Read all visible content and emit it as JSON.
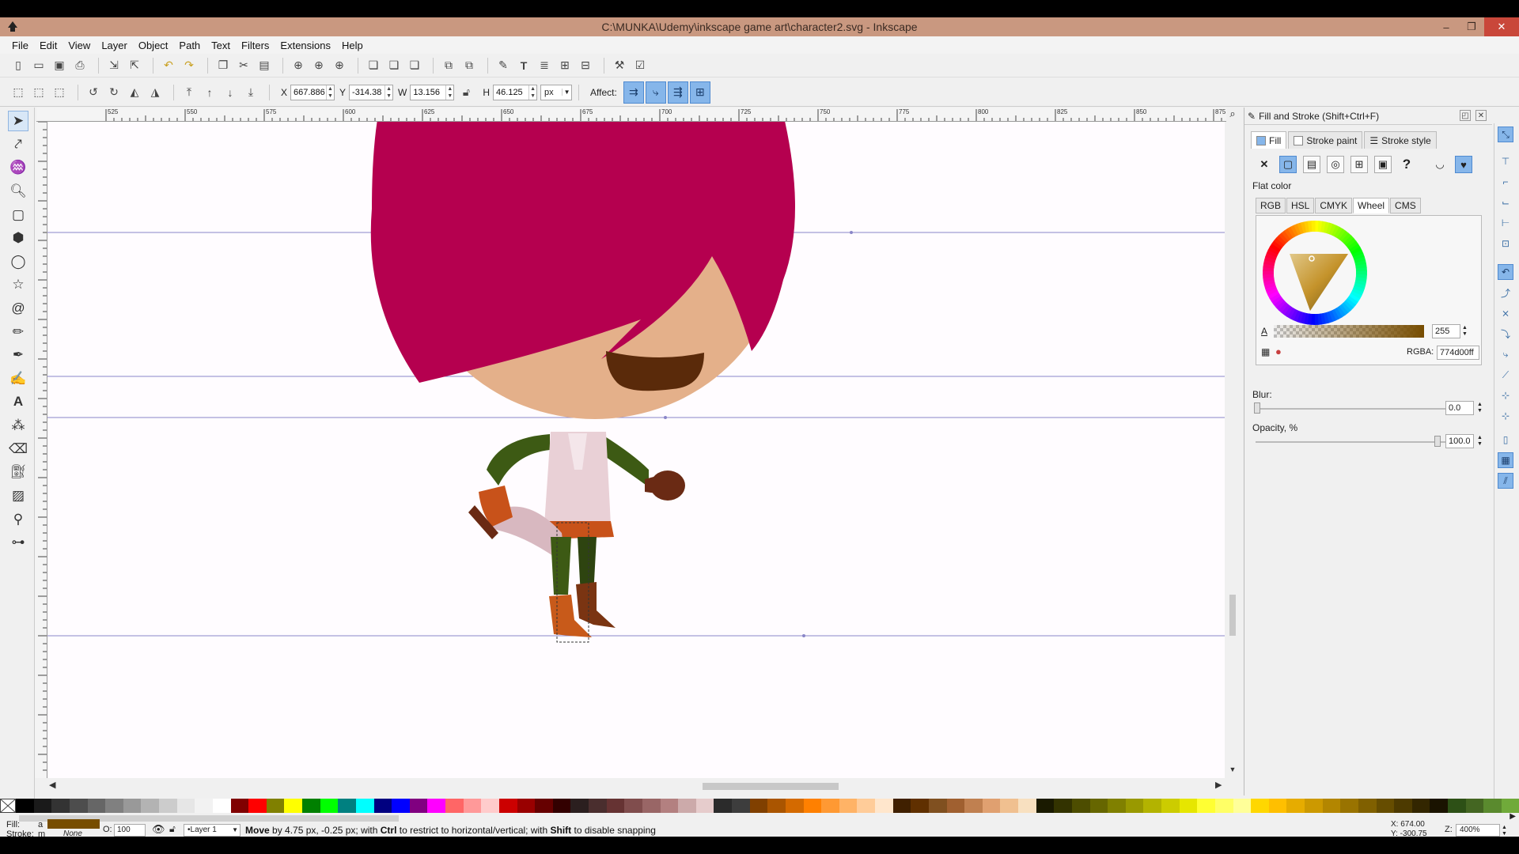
{
  "window": {
    "title": "C:\\MUNKA\\Udemy\\inkscape game art\\character2.svg - Inkscape",
    "controls": [
      "–",
      "❐",
      "✕"
    ]
  },
  "menubar": [
    "File",
    "Edit",
    "View",
    "Layer",
    "Object",
    "Path",
    "Text",
    "Filters",
    "Extensions",
    "Help"
  ],
  "controls_bar": {
    "x_label": "X",
    "x_value": "667.886",
    "y_label": "Y",
    "y_value": "-314.38",
    "w_label": "W",
    "w_value": "13.156",
    "h_label": "H",
    "h_value": "46.125",
    "unit": "px",
    "affect_label": "Affect:"
  },
  "rulers": {
    "horizontal_labels": [
      "525",
      "550",
      "575",
      "600",
      "625",
      "650",
      "675",
      "700",
      "725",
      "750",
      "775",
      "800",
      "825",
      "850",
      "875"
    ]
  },
  "fill_stroke": {
    "title": "Fill and Stroke (Shift+Ctrl+F)",
    "tabs": [
      "Fill",
      "Stroke paint",
      "Stroke style"
    ],
    "flat_color_label": "Flat color",
    "color_tabs": [
      "RGB",
      "HSL",
      "CMYK",
      "Wheel",
      "CMS"
    ],
    "active_color_tab": "Wheel",
    "alpha_label": "A",
    "alpha_value": "255",
    "rgba_label": "RGBA:",
    "rgba_value": "774d00ff",
    "blur_label": "Blur:",
    "blur_value": "0.0",
    "opacity_label": "Opacity, %",
    "opacity_value": "100.0",
    "current_color": "#774d00"
  },
  "statusbar": {
    "fill_label": "Fill:",
    "fill_marker": "a",
    "stroke_label": "Stroke:",
    "stroke_marker": "m",
    "stroke_value": "None",
    "opacity_label": "O:",
    "opacity_value": "100",
    "layer": "•Layer 1",
    "message_prefix": "Move",
    "message_body": " by 4.75 px, -0.25 px; with ",
    "message_ctrl": "Ctrl",
    "message_mid": " to restrict to horizontal/vertical; with ",
    "message_shift": "Shift",
    "message_end": " to disable snapping",
    "cursor_x": "X:  674.00",
    "cursor_y": "Y:  -300.75",
    "zoom_label": "Z:",
    "zoom_value": "400%"
  },
  "palette": [
    "#000000",
    "#1a1a1a",
    "#333333",
    "#4d4d4d",
    "#666666",
    "#808080",
    "#999999",
    "#b3b3b3",
    "#cccccc",
    "#e6e6e6",
    "#f2f2f2",
    "#ffffff",
    "#800000",
    "#ff0000",
    "#808000",
    "#ffff00",
    "#008000",
    "#00ff00",
    "#008080",
    "#00ffff",
    "#000080",
    "#0000ff",
    "#800080",
    "#ff00ff",
    "#ff6666",
    "#ff9999",
    "#ffcccc",
    "#cc0000",
    "#990000",
    "#660000",
    "#330000",
    "#2b1f1f",
    "#4a2e2e",
    "#663333",
    "#804d4d",
    "#996666",
    "#b38080",
    "#ccaaaa",
    "#e6cccc",
    "#2b2b2b",
    "#3d3d3d",
    "#804000",
    "#aa5500",
    "#d46a00",
    "#ff8000",
    "#ff9933",
    "#ffb366",
    "#ffcc99",
    "#ffe6cc",
    "#402000",
    "#603000",
    "#805020",
    "#a06030",
    "#c08050",
    "#e0a070",
    "#f0c090",
    "#f8e0c0",
    "#1a1a00",
    "#333300",
    "#4d4d00",
    "#666600",
    "#808000",
    "#999900",
    "#b3b300",
    "#cccc00",
    "#e6e600",
    "#ffff33",
    "#ffff66",
    "#ffff99",
    "#ffd700",
    "#ffbf00",
    "#e6ac00",
    "#cc9900",
    "#b38600",
    "#997300",
    "#806000",
    "#664d00",
    "#4d3a00",
    "#332600",
    "#1a1300",
    "#2d5016",
    "#446622",
    "#5a8a2e",
    "#70aa3a"
  ],
  "colors": {
    "hair": "#b5004f",
    "skin": "#e4b08a",
    "mouth": "#5a2a0a",
    "arm": "#3d5a14",
    "shirt": "#e9d0d6",
    "belt": "#c8521a",
    "glove": "#6a2a14",
    "boot": "#c85a1a",
    "boot_dark": "#7a3412",
    "sword": "#d8b8c0"
  }
}
